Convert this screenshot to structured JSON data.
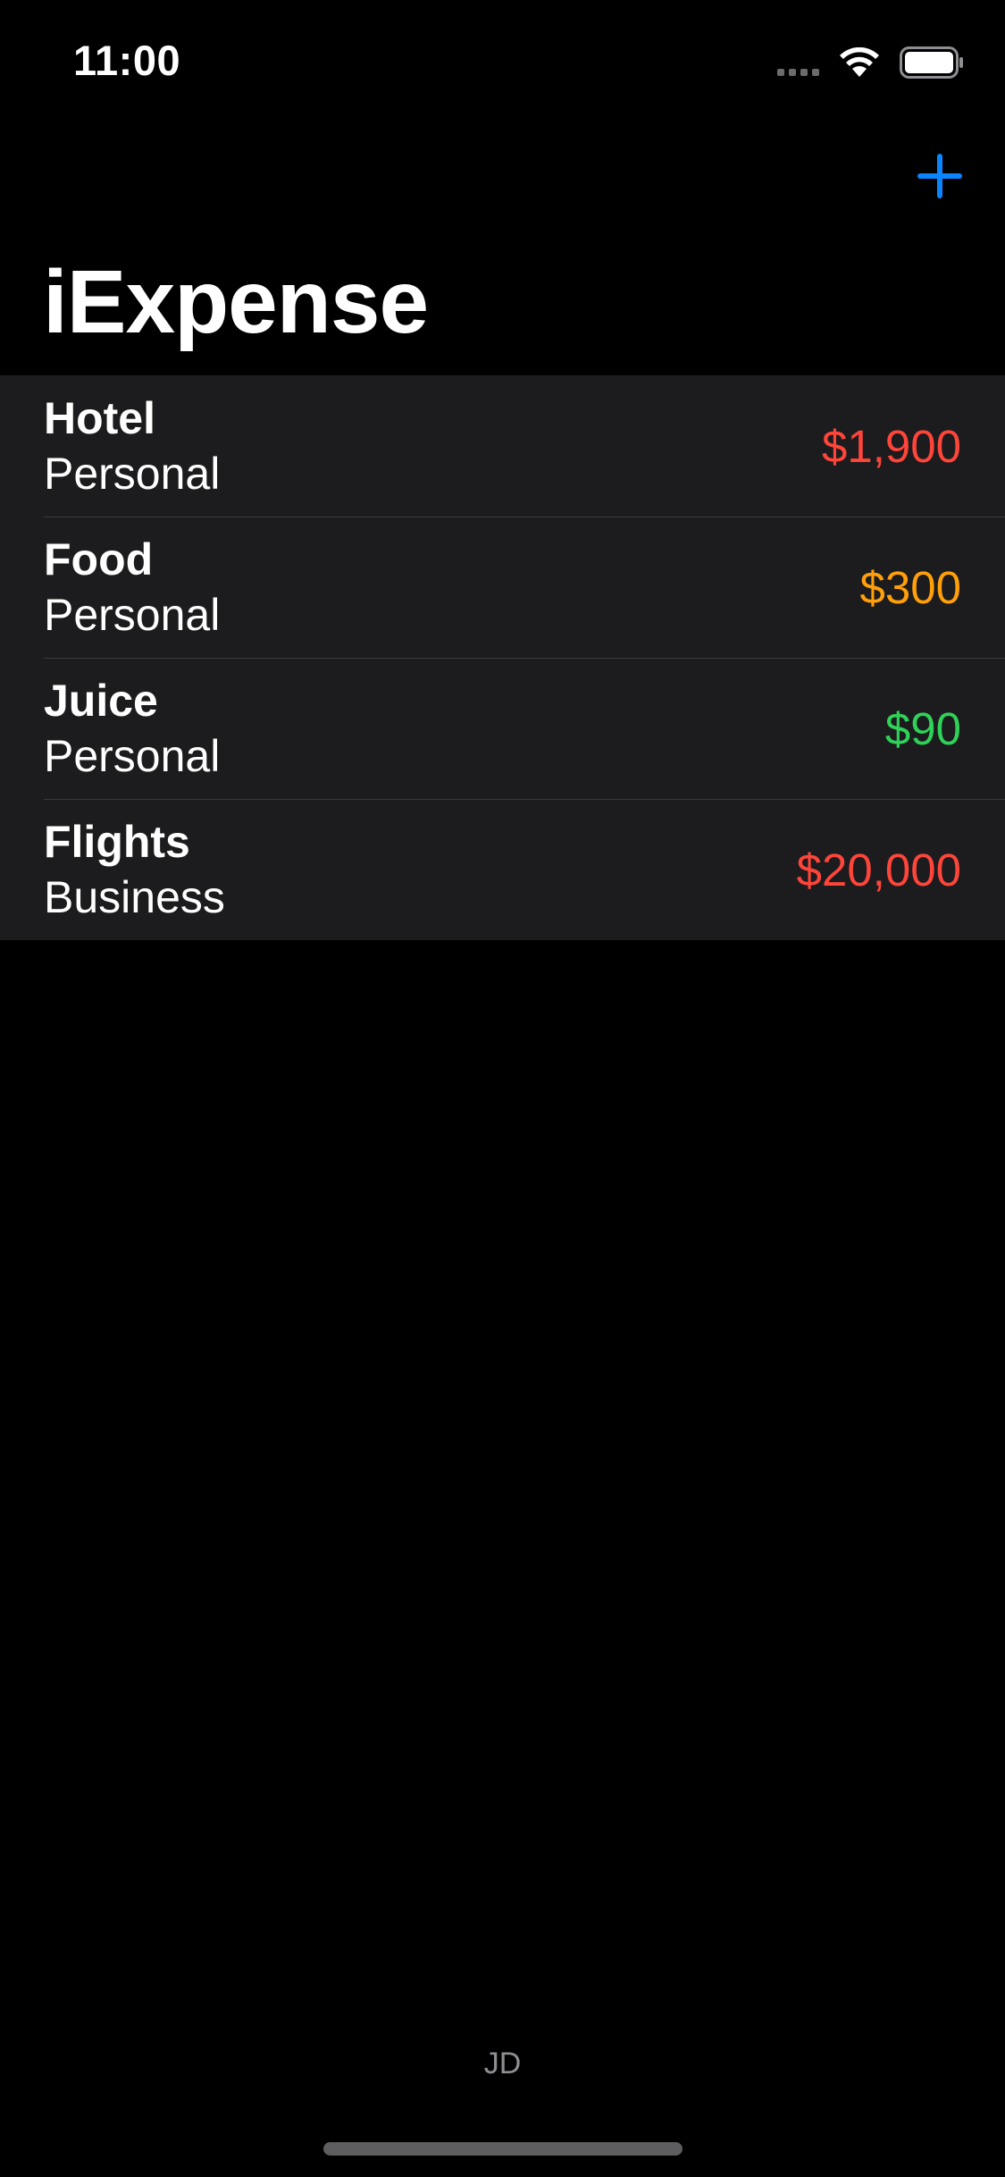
{
  "status_bar": {
    "time": "11:00"
  },
  "nav": {
    "title": "iExpense",
    "add_icon": "plus-icon",
    "accent_color": "#0a84ff"
  },
  "expenses": [
    {
      "name": "Hotel",
      "type": "Personal",
      "amount": "$1,900",
      "amount_color": "#ff453a"
    },
    {
      "name": "Food",
      "type": "Personal",
      "amount": "$300",
      "amount_color": "#ff9f0a"
    },
    {
      "name": "Juice",
      "type": "Personal",
      "amount": "$90",
      "amount_color": "#30d158"
    },
    {
      "name": "Flights",
      "type": "Business",
      "amount": "$20,000",
      "amount_color": "#ff453a"
    }
  ],
  "footer": {
    "initials": "JD"
  }
}
